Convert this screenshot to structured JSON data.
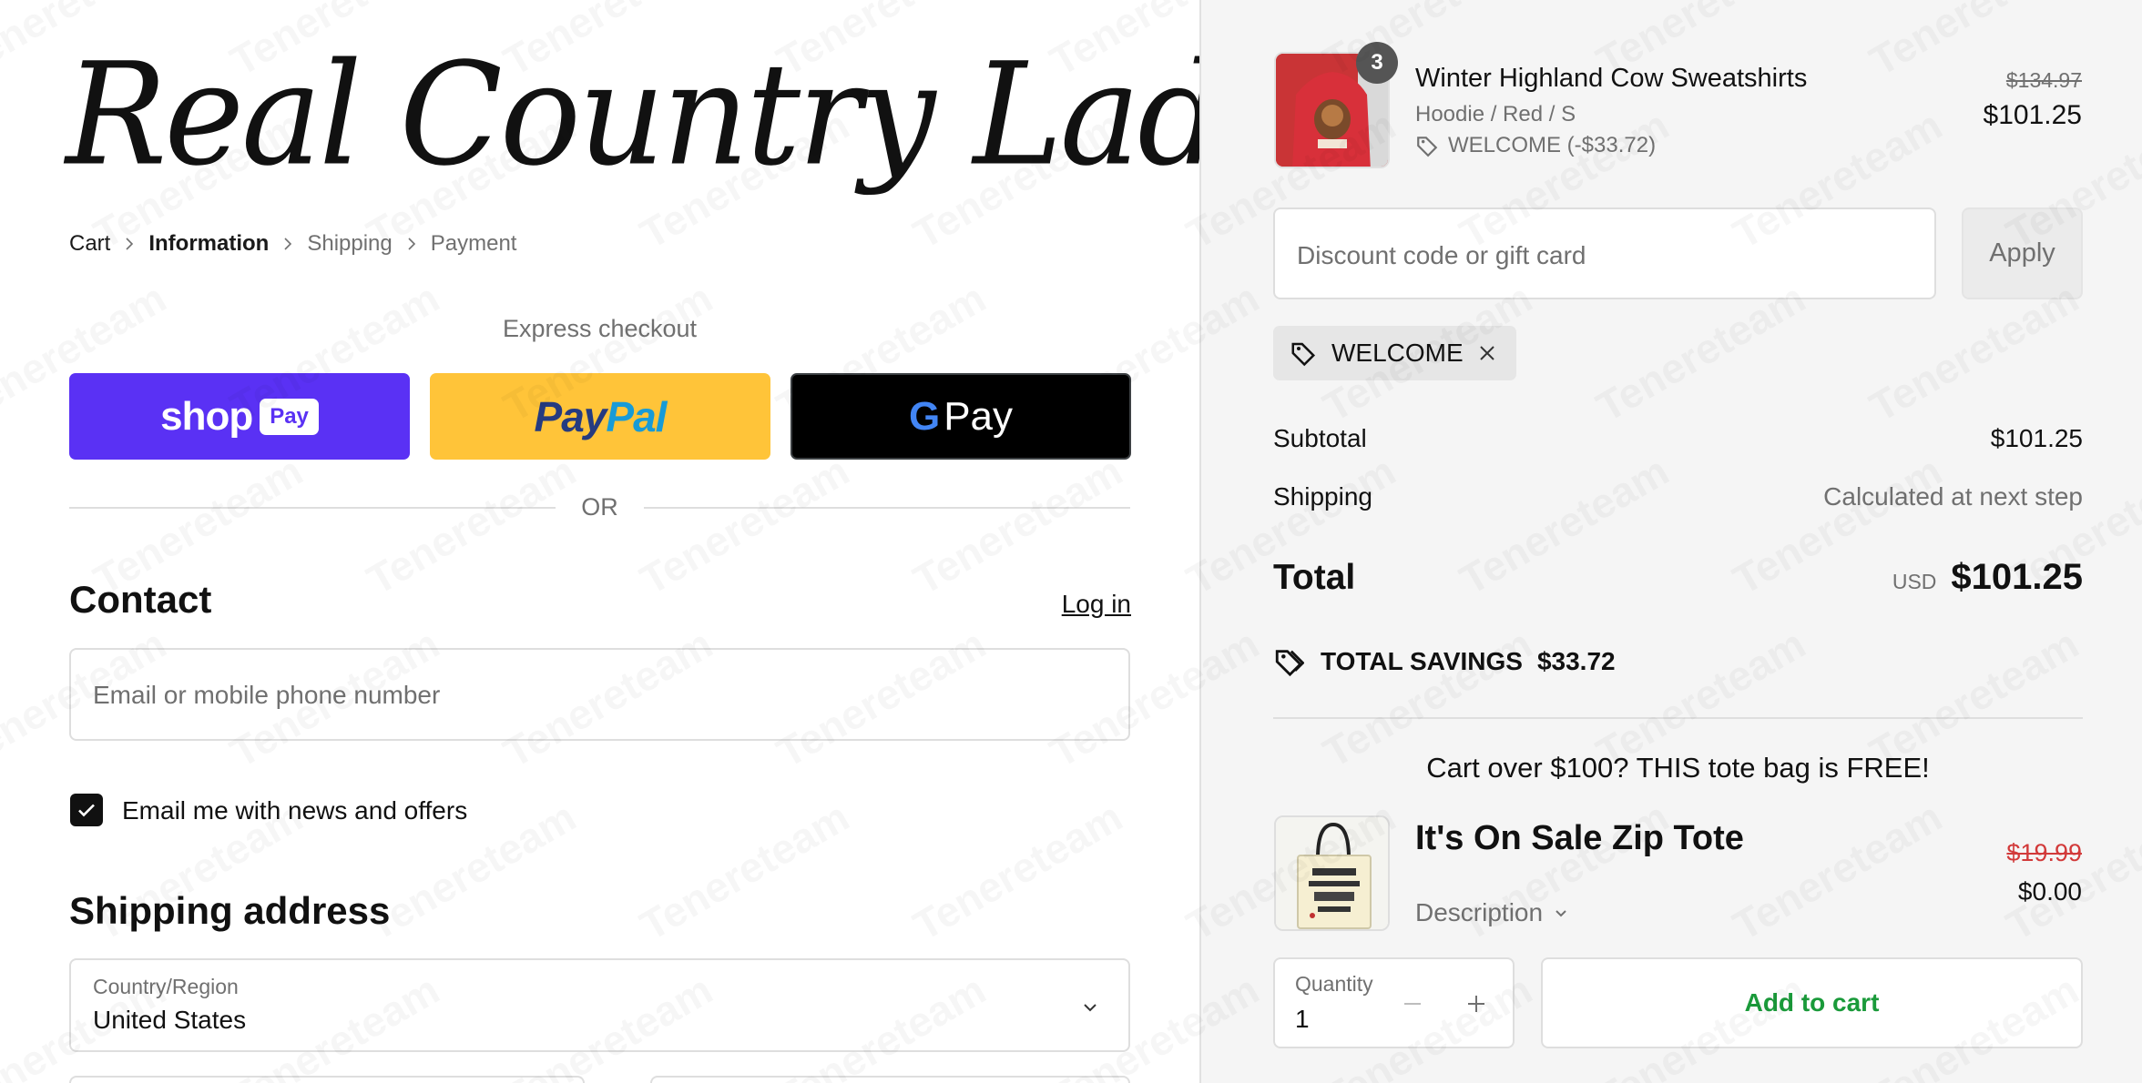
{
  "store": {
    "name": "Real Country Ladies"
  },
  "breadcrumb": {
    "items": [
      {
        "label": "Cart"
      },
      {
        "label": "Information"
      },
      {
        "label": "Shipping"
      },
      {
        "label": "Payment"
      }
    ]
  },
  "express": {
    "label": "Express checkout",
    "shop_label": "shop",
    "shop_badge": "Pay",
    "paypal_part1": "Pay",
    "paypal_part2": "Pal",
    "gpay_g": "G",
    "gpay_label": "Pay",
    "or_label": "OR"
  },
  "contact": {
    "title": "Contact",
    "login_label": "Log in",
    "email_placeholder": "Email or mobile phone number",
    "newsletter_label": "Email me with news and offers",
    "newsletter_checked": true
  },
  "shipping_address": {
    "title": "Shipping address",
    "country_label": "Country/Region",
    "country_value": "United States"
  },
  "order": {
    "item": {
      "name": "Winter Highland Cow Sweatshirts",
      "variant": "Hoodie / Red / S",
      "discount": "WELCOME (-$33.72)",
      "quantity": "3",
      "price_original": "$134.97",
      "price": "$101.25"
    },
    "discount_placeholder": "Discount code or gift card",
    "apply_label": "Apply",
    "applied_code": "WELCOME",
    "subtotal_label": "Subtotal",
    "subtotal_value": "$101.25",
    "shipping_label": "Shipping",
    "shipping_value": "Calculated at next step",
    "total_label": "Total",
    "total_currency": "USD",
    "total_value": "$101.25",
    "savings_label": "TOTAL SAVINGS",
    "savings_value": "$33.72"
  },
  "upsell": {
    "title": "Cart over $100? THIS tote bag is FREE!",
    "name": "It's On Sale Zip Tote",
    "price_original": "$19.99",
    "price": "$0.00",
    "description_label": "Description",
    "quantity_label": "Quantity",
    "quantity_value": "1",
    "add_label": "Add to cart"
  },
  "watermark": {
    "text": "Tenereteam"
  },
  "colors": {
    "shop_pay": "#5a31f4",
    "paypal": "#ffc439",
    "gpay": "#000000",
    "add_to_cart": "#1a9a3a",
    "strike_red": "#d23a3a"
  }
}
